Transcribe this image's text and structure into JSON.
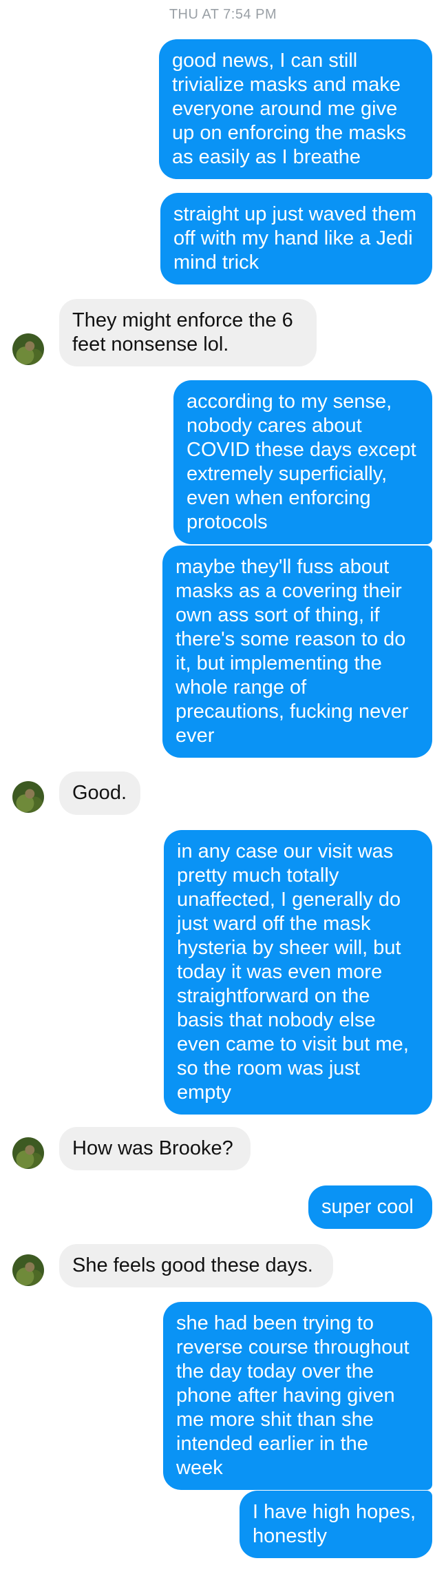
{
  "header": {
    "timestamp": "THU AT 7:54 PM"
  },
  "messages": [
    {
      "side": "out",
      "text": "good news, I can still trivialize masks and make everyone around me give up on enforcing the masks as easily as I breathe"
    },
    {
      "side": "out",
      "text": "straight up just waved them off with my hand like a Jedi mind trick"
    },
    {
      "side": "in",
      "text": "They might enforce the 6 feet nonsense lol."
    },
    {
      "side": "out",
      "text": "according to my sense, nobody cares about COVID these days except extremely superficially, even when enforcing protocols"
    },
    {
      "side": "out",
      "text": "maybe they'll fuss about masks as a covering their own ass sort of thing, if there's some reason to do it, but implementing the whole range of precautions, fucking never ever"
    },
    {
      "side": "in",
      "text": "Good."
    },
    {
      "side": "out",
      "text": "in any case our visit was pretty much totally unaffected, I generally do just ward off the mask hysteria by sheer will, but today it was even more straightforward on the basis that nobody else even came to visit but me, so the room was just empty"
    },
    {
      "side": "in",
      "text": "How was Brooke?"
    },
    {
      "side": "out",
      "text": "super cool"
    },
    {
      "side": "in",
      "text": "She feels good these days."
    },
    {
      "side": "out",
      "text": "she had been trying to reverse course throughout the day today over the phone after having given me more shit than she intended earlier in the week"
    },
    {
      "side": "out",
      "text": "I have high hopes, honestly"
    }
  ],
  "colors": {
    "outgoing_bubble": "#0a93f5",
    "incoming_bubble": "#efefef",
    "timestamp": "#9aa0a6"
  }
}
